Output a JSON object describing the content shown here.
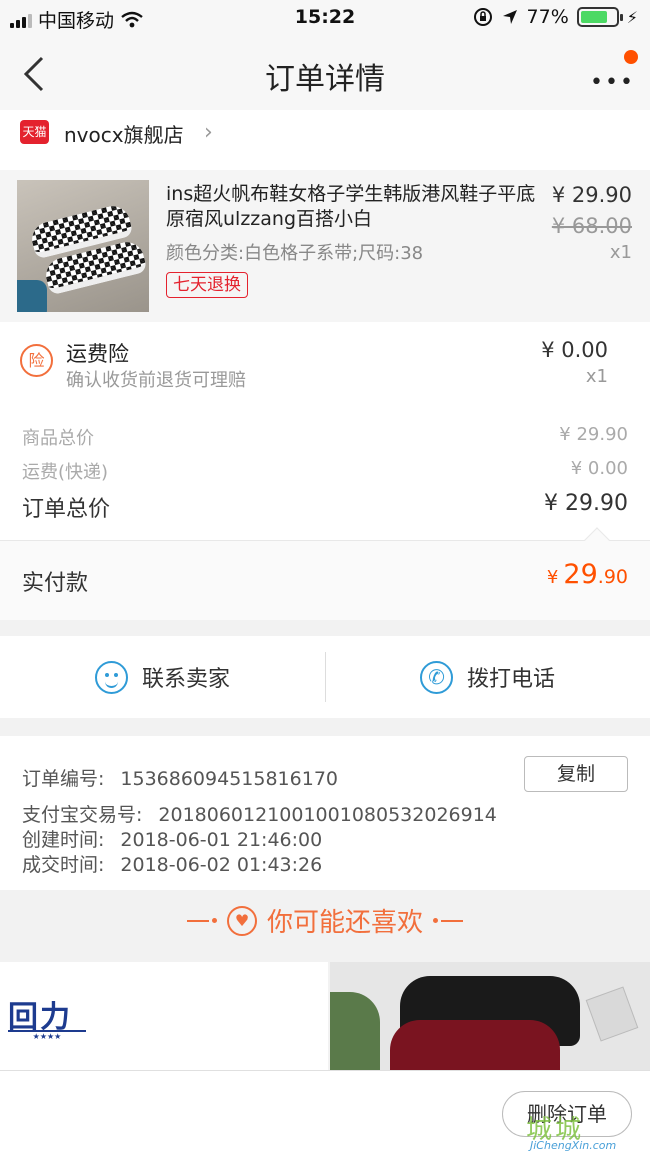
{
  "status": {
    "carrier": "中国移动",
    "time": "15:22",
    "battery": "77%",
    "battery_level": 0.77
  },
  "nav": {
    "title": "订单详情"
  },
  "store": {
    "badge": "天猫",
    "name": "nvocx旗舰店"
  },
  "product": {
    "title": "ins超火帆布鞋女格子学生韩版港风鞋子平底原宿风ulzzang百搭小白",
    "attr": "颜色分类:白色格子系带;尺码:38",
    "tag": "七天退换",
    "price": "¥ 29.90",
    "orig_price": "¥ 68.00",
    "qty": "x1"
  },
  "insurance": {
    "icon_text": "险",
    "title": "运费险",
    "desc": "确认收货前退货可理赔",
    "amount": "¥ 0.00",
    "qty": "x1"
  },
  "summary": {
    "goods_label": "商品总价",
    "goods_value": "¥ 29.90",
    "ship_label": "运费(快递)",
    "ship_value": "¥ 0.00",
    "total_label": "订单总价",
    "total_value": "¥ 29.90"
  },
  "paid": {
    "label": "实付款",
    "currency": "¥",
    "int": "29",
    "dec": ".90"
  },
  "contact": {
    "seller": "联系卖家",
    "phone": "拨打电话"
  },
  "order": {
    "no_label": "订单编号:",
    "no_value": "1536860945158161 70",
    "copy": "复制",
    "alipay_label": "支付宝交易号:",
    "alipay_value": "2018060121001001080532026914",
    "created_label": "创建时间:",
    "created_value": "2018-06-01 21:46:00",
    "deal_label": "成交时间:",
    "deal_value": "2018-06-02 01:43:26"
  },
  "recommend": {
    "title": "你可能还喜欢",
    "brand_logo": "回力",
    "brand_stars": "★★★★"
  },
  "bottom": {
    "delete": "删除订单"
  },
  "watermark": {
    "logo": "城城",
    "url": "JiChengXin.com"
  },
  "colors": {
    "accent": "#ff5000",
    "link_blue": "#2f9bd7",
    "tmall_red": "#e4222e",
    "insure_orange": "#f26f3c",
    "battery_green": "#4cd964"
  },
  "icons": {
    "back": "chevron-left-icon",
    "more": "more-dots-icon",
    "store_chevron": "chevron-right-icon",
    "insurance": "insurance-icon",
    "chat": "chat-icon",
    "phone": "phone-icon",
    "heart": "heart-icon"
  }
}
